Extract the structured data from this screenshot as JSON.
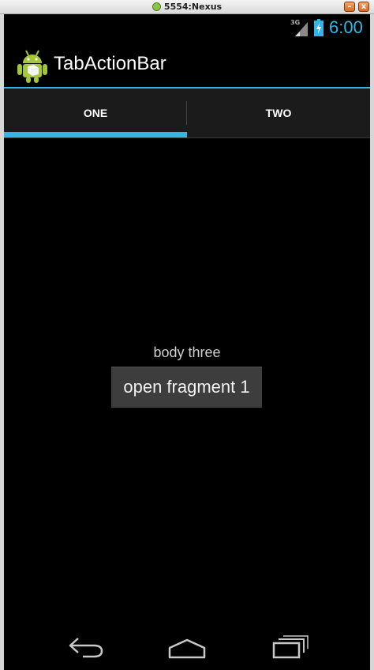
{
  "window": {
    "title": "5554:Nexus",
    "minimize_label": "–",
    "close_label": "x"
  },
  "status_bar": {
    "network": "3G",
    "time": "6:00"
  },
  "action_bar": {
    "title": "TabActionBar",
    "icon": "android-robot-icon"
  },
  "tabs": [
    {
      "label": "ONE",
      "selected": true
    },
    {
      "label": "TWO",
      "selected": false
    }
  ],
  "content": {
    "body_text": "body three",
    "button_label": "open fragment 1"
  },
  "nav_bar": {
    "icons": [
      "back-icon",
      "home-icon",
      "recent-apps-icon"
    ]
  },
  "colors": {
    "accent": "#33b5e5",
    "background": "#000000",
    "tab_bar": "#1b1b1b",
    "button": "#3d3d3d"
  }
}
